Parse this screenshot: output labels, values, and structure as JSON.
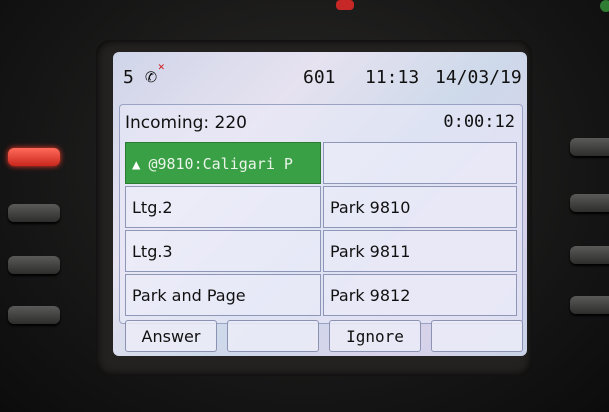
{
  "status_bar": {
    "count": "5",
    "icon": "phone-missed-icon",
    "extension": "601",
    "time": "11:13",
    "date": "14/03/19"
  },
  "call": {
    "incoming": "Incoming: 220",
    "timer": "0:00:12"
  },
  "lines": {
    "left": [
      {
        "label": "@9810:Caligari P",
        "icon": "bell-icon",
        "highlighted": true
      },
      {
        "label": "Ltg.2"
      },
      {
        "label": "Ltg.3"
      },
      {
        "label": "Park and Page"
      }
    ],
    "right": [
      {
        "label": ""
      },
      {
        "label": "Park 9810"
      },
      {
        "label": "Park 9811"
      },
      {
        "label": "Park 9812"
      }
    ]
  },
  "softkeys": [
    {
      "label": "Answer"
    },
    {
      "label": ""
    },
    {
      "label": "Ignore"
    },
    {
      "label": ""
    }
  ],
  "colors": {
    "alert_green": "#3aa046",
    "line_led_red": "#c9271d",
    "missed_call_red": "#d01818"
  }
}
